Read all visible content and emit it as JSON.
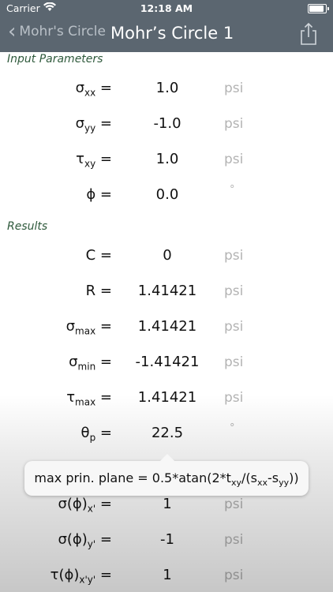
{
  "status": {
    "carrier": "Carrier",
    "time": "12:18 AM"
  },
  "nav": {
    "back_label": "Mohr's Circle",
    "title": "Mohr’s Circle 1"
  },
  "sections": {
    "input": "Input Parameters",
    "results": "Results"
  },
  "rows": {
    "sxx": {
      "label_main": "σ",
      "label_sub": "xx",
      "label_tail": " =",
      "value": "1.0",
      "unit": "psi"
    },
    "syy": {
      "label_main": "σ",
      "label_sub": "yy",
      "label_tail": " =",
      "value": "-1.0",
      "unit": "psi"
    },
    "txy": {
      "label_main": "τ",
      "label_sub": "xy",
      "label_tail": " =",
      "value": "1.0",
      "unit": "psi"
    },
    "phi": {
      "label_main": "ϕ",
      "label_sub": "",
      "label_tail": " =",
      "value": "0.0",
      "unit": "°"
    },
    "C": {
      "label_main": "C",
      "label_sub": "",
      "label_tail": " =",
      "value": "0",
      "unit": "psi"
    },
    "R": {
      "label_main": "R",
      "label_sub": "",
      "label_tail": " =",
      "value": "1.41421",
      "unit": "psi"
    },
    "smax": {
      "label_main": "σ",
      "label_sub": "max",
      "label_tail": " =",
      "value": "1.41421",
      "unit": "psi"
    },
    "smin": {
      "label_main": "σ",
      "label_sub": "min",
      "label_tail": " =",
      "value": "-1.41421",
      "unit": "psi"
    },
    "tmax": {
      "label_main": "τ",
      "label_sub": "max",
      "label_tail": " =",
      "value": "1.41421",
      "unit": "psi"
    },
    "thp": {
      "label_main": "θ",
      "label_sub": "p",
      "label_tail": " =",
      "value": "22.5",
      "unit": "°"
    },
    "sx": {
      "label_main": "σ(ϕ)",
      "label_sub": "x'",
      "label_tail": " =",
      "value": "1",
      "unit": "psi"
    },
    "sy": {
      "label_main": "σ(ϕ)",
      "label_sub": "y'",
      "label_tail": " =",
      "value": "-1",
      "unit": "psi"
    },
    "txyp": {
      "label_main": "τ(ϕ)",
      "label_sub": "x'y'",
      "label_tail": " =",
      "value": "1",
      "unit": "psi"
    }
  },
  "tooltip": {
    "prefix": "max prin. plane = 0.5*atan(2*t",
    "sub1": "xy",
    "mid": "/(s",
    "sub2": "xx",
    "dash": "-s",
    "sub3": "yy",
    "suffix": "))"
  }
}
